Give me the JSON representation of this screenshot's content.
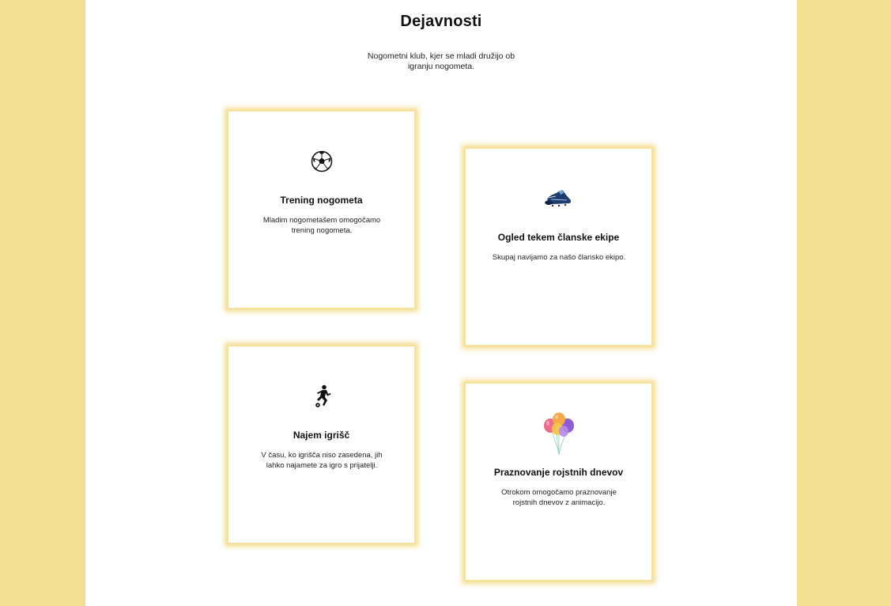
{
  "section": {
    "title": "Dejavnosti",
    "subtitle": "Nogometni klub, kjer se mladi družijo ob igranju nogometa."
  },
  "cards": [
    {
      "icon": "soccer-ball-icon",
      "title": "Trening nogometa",
      "description": "Mladim nogometašem omogočamo trening nogometa."
    },
    {
      "icon": "football-boot-icon",
      "title": "Ogled tekem članske ekipe",
      "description": "Skupaj navijamo za našo člansko ekipo."
    },
    {
      "icon": "soccer-player-icon",
      "title": "Najem igrišč",
      "description": "V času, ko igrišča niso zasedena, jih lahko najamete za igro s prijatelji."
    },
    {
      "icon": "balloons-icon",
      "title": "Praznovanje rojstnih dnevov",
      "description": "Otrokom omogočamo praznovanje rojstnih dnevov z animacijo."
    }
  ],
  "colors": {
    "background": "#f3df92",
    "card_glow": "#f2d67a",
    "panel": "#ffffff"
  }
}
